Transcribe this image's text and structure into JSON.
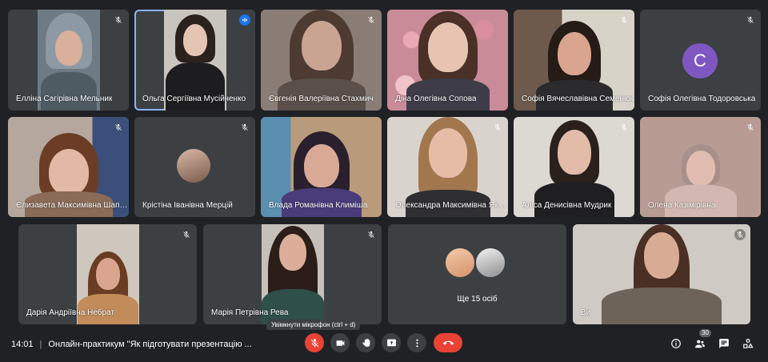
{
  "participants": [
    {
      "name": "Елліна Сагірівна Мельник"
    },
    {
      "name": "Ольга Сергіївна Мусійченко"
    },
    {
      "name": "Євгенія Валеріївна Стахмич"
    },
    {
      "name": "Діна Олегівна Сопова"
    },
    {
      "name": "Софія Вячеславівна Семенюк"
    },
    {
      "name": "Софія Олегівна Тодоровська",
      "avatar_letter": "C"
    },
    {
      "name": "Єлизавета Максимівна Шапошник"
    },
    {
      "name": "Крістіна Іванівна Мерцій"
    },
    {
      "name": "Влада Романівна Климіша"
    },
    {
      "name": "Олександра Максимівна Яковенко"
    },
    {
      "name": "Аліса Денисівна Мудрик"
    },
    {
      "name": "Олена Казімірівна"
    },
    {
      "name": "Дарія Андріївна Небрат"
    },
    {
      "name": "Марія Петрівна Рева"
    },
    {
      "name": "Ще 15 осіб"
    },
    {
      "name": "Ви"
    }
  ],
  "bottom_bar": {
    "time": "14:01",
    "separator": "|",
    "meeting_title": "Онлайн-практикум \"Як підготувати презентацію ...",
    "mic_tooltip": "Увімкнути мікрофон (ctrl + d)",
    "participants_count": "30"
  },
  "icons": {
    "mic_off": "mic-off-icon",
    "camera": "camera-icon",
    "raise_hand": "hand-icon",
    "present": "present-icon",
    "more": "more-vert-icon",
    "end_call": "phone-end-icon",
    "info": "info-icon",
    "people": "people-icon",
    "chat": "chat-icon",
    "activities": "activities-icon"
  },
  "colors": {
    "background": "#202124",
    "tile": "#3c4043",
    "accent": "#1a73e8",
    "end_call": "#ea4335",
    "avatar": "#7e57c2"
  }
}
